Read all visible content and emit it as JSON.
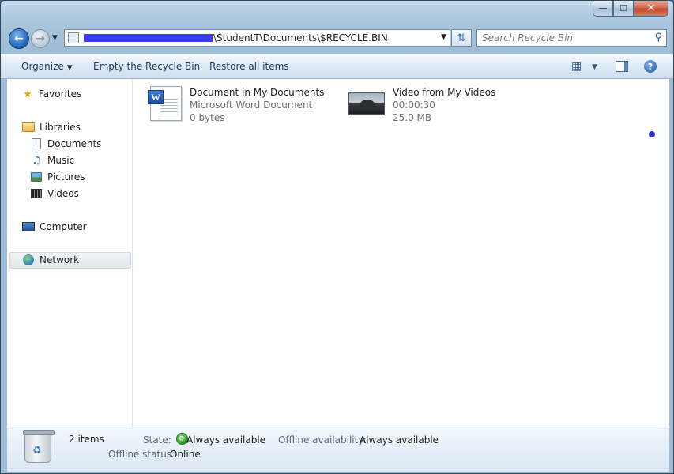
{
  "window": {
    "caption_min": "—",
    "caption_max": "☐",
    "caption_close": "✕"
  },
  "address": {
    "path_suffix": "\\StudentT\\Documents\\$RECYCLE.BIN"
  },
  "search": {
    "placeholder": "Search Recycle Bin"
  },
  "toolbar": {
    "organize": "Organize",
    "empty": "Empty the Recycle Bin",
    "restore": "Restore all items"
  },
  "nav": {
    "favorites": "Favorites",
    "libraries": "Libraries",
    "documents": "Documents",
    "music": "Music",
    "pictures": "Pictures",
    "videos": "Videos",
    "computer": "Computer",
    "network": "Network"
  },
  "files": [
    {
      "name": "Document in My Documents",
      "line2": "Microsoft Word Document",
      "line3": "0 bytes",
      "icon": "word-document-icon"
    },
    {
      "name": "Video from My Videos",
      "line2": "00:00:30",
      "line3": "25.0 MB",
      "icon": "video-thumbnail-icon"
    }
  ],
  "details": {
    "count": "2 items",
    "state_label": "State:",
    "state_value": "Always available",
    "offline_avail_label": "Offline availability:",
    "offline_avail_value": "Always available",
    "offline_status_label": "Offline status:",
    "offline_status_value": "Online"
  },
  "colors": {
    "toolbar_text": "#1e395b",
    "address_redaction": "#3b3df0",
    "accent_dot": "#3030d8"
  }
}
